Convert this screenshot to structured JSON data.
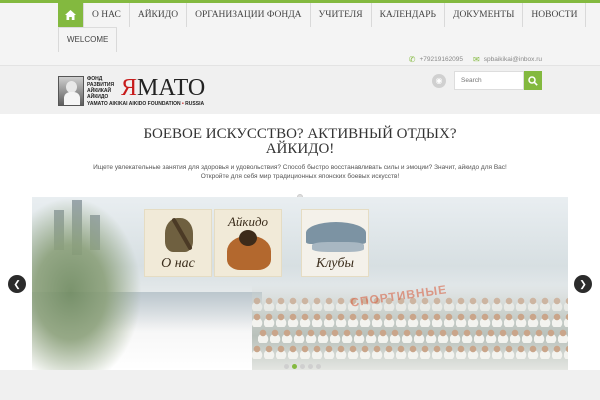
{
  "nav": {
    "items": [
      "О НАС",
      "АЙКИДО",
      "ОРГАНИЗАЦИИ ФОНДА",
      "УЧИТЕЛЯ",
      "КАЛЕНДАРЬ",
      "ДОКУМЕНТЫ",
      "НОВОСТИ"
    ],
    "second_row": [
      "WELCOME"
    ],
    "home_icon": "home-icon",
    "accent_color": "#83b93f"
  },
  "contacts": {
    "phone": "+79219162095",
    "email": "spbaikikai@inbox.ru"
  },
  "logo": {
    "small_line1": "ФОНД",
    "small_line2": "РАЗВИТИЯ",
    "small_line3": "АЙКИКАЙ",
    "small_line4": "АЙКИДО",
    "main_red": "Я",
    "main_black": "МАТО",
    "subtitle": "YAMATO AIKIKAI AIKIDO FOUNDATION",
    "subtitle_dot": "•",
    "subtitle_country": "RUSSIA"
  },
  "search": {
    "placeholder": "Search"
  },
  "hero": {
    "title_line1": "БОЕВОЕ ИСКУССТВО? АКТИВНЫЙ ОТДЫХ? АЙКИДО!",
    "title_line2": "",
    "text_line1": "Ищете увлекательные занятия для здоровья и удовольствия? Способ быстро восстанавливать силы и эмоции? Значит, айкидо для Вас!",
    "text_line2": "Откройте для себя мир традиционных японских боевых искусств!"
  },
  "slider": {
    "card1": "О нас",
    "card2": "Айкидо",
    "card3": "Клубы",
    "banner": "СПОРТИВНЫЕ",
    "prev_icon": "chevron-left-icon",
    "next_icon": "chevron-right-icon",
    "dot_count": 5,
    "active_dot": 1
  }
}
